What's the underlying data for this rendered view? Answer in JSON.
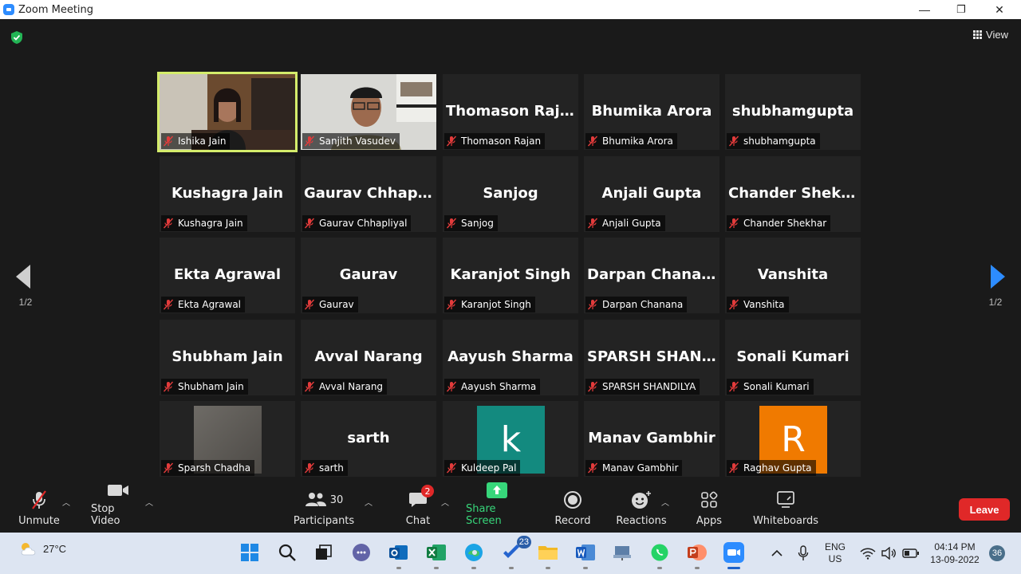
{
  "window": {
    "title": "Zoom Meeting",
    "minimize": "—",
    "maximize": "❐",
    "close": "✕"
  },
  "header": {
    "view_label": "View"
  },
  "pager": {
    "left": "1/2",
    "right": "1/2"
  },
  "participants": [
    {
      "display": "",
      "label": "Ishika Jain",
      "video": true
    },
    {
      "display": "",
      "label": "Sanjith Vasudev",
      "video": true
    },
    {
      "display": "Thomason Rajan",
      "label": "Thomason Rajan"
    },
    {
      "display": "Bhumika Arora",
      "label": "Bhumika Arora"
    },
    {
      "display": "shubhamgupta",
      "label": "shubhamgupta"
    },
    {
      "display": "Kushagra Jain",
      "label": "Kushagra Jain"
    },
    {
      "display": "Gaurav Chhapliyal",
      "label": "Gaurav Chhapliyal"
    },
    {
      "display": "Sanjog",
      "label": "Sanjog"
    },
    {
      "display": "Anjali Gupta",
      "label": "Anjali Gupta"
    },
    {
      "display": "Chander Shekhar",
      "label": "Chander Shekhar"
    },
    {
      "display": "Ekta Agrawal",
      "label": "Ekta Agrawal"
    },
    {
      "display": "Gaurav",
      "label": "Gaurav"
    },
    {
      "display": "Karanjot Singh",
      "label": "Karanjot Singh"
    },
    {
      "display": "Darpan Chanana",
      "label": "Darpan Chanana"
    },
    {
      "display": "Vanshita",
      "label": "Vanshita"
    },
    {
      "display": "Shubham Jain",
      "label": "Shubham Jain"
    },
    {
      "display": "Avval Narang",
      "label": "Avval Narang"
    },
    {
      "display": "Aayush Sharma",
      "label": "Aayush Sharma"
    },
    {
      "display": "SPARSH  SHAND...",
      "label": "SPARSH SHANDILYA"
    },
    {
      "display": "Sonali Kumari",
      "label": "Sonali Kumari"
    },
    {
      "display": "",
      "label": "Sparsh Chadha",
      "photo": true
    },
    {
      "display": "sarth",
      "label": "sarth"
    },
    {
      "display": "",
      "label": "Kuldeep Pal",
      "avatar_letter": "k",
      "avatar_color": "#138a7f"
    },
    {
      "display": "Manav Gambhir",
      "label": "Manav Gambhir"
    },
    {
      "display": "",
      "label": "Raghav Gupta",
      "avatar_letter": "R",
      "avatar_color": "#f07a00"
    }
  ],
  "toolbar": {
    "unmute": "Unmute",
    "stop_video": "Stop Video",
    "participants": "Participants",
    "participants_count": "30",
    "chat": "Chat",
    "chat_badge": "2",
    "share_screen": "Share Screen",
    "record": "Record",
    "reactions": "Reactions",
    "apps": "Apps",
    "whiteboards": "Whiteboards",
    "leave": "Leave"
  },
  "taskbar": {
    "weather": "27°C",
    "mail_badge": "",
    "tasks_badge": "23",
    "lang_top": "ENG",
    "lang_bottom": "US",
    "time": "04:14 PM",
    "date": "13-09-2022",
    "notifications": "36"
  },
  "colors": {
    "active_speaker": "#d4ec6b",
    "share_green": "#37d67a",
    "leave_red": "#e02828",
    "accent_blue": "#2d8cff"
  }
}
